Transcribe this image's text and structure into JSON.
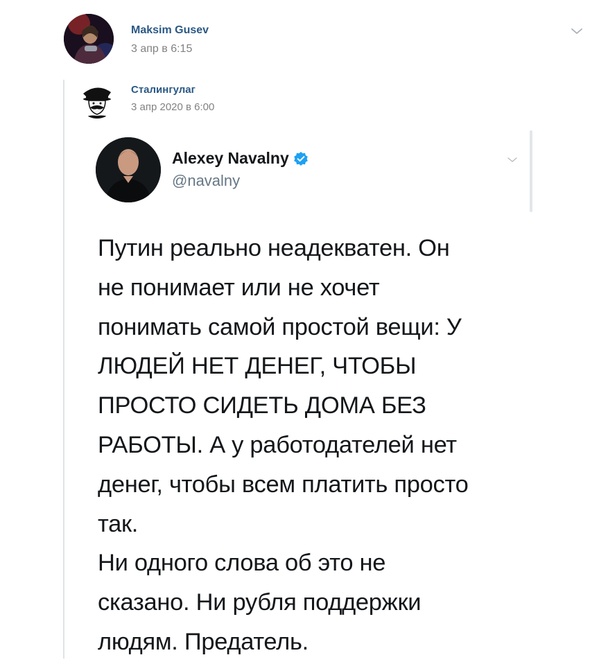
{
  "post": {
    "author": "Maksim Gusev",
    "date": "3 апр в 6:15"
  },
  "repost": {
    "author": "Сталингулаг",
    "date": "3 апр 2020 в 6:00"
  },
  "tweet": {
    "name": "Alexey Navalny",
    "handle": "@navalny",
    "lines": [
      "Путин реально неадекватен. Он",
      "не понимает или не хочет",
      "понимать самой простой вещи: У",
      "ЛЮДЕЙ НЕТ ДЕНЕГ, ЧТОБЫ",
      "ПРОСТО СИДЕТЬ ДОМА БЕЗ",
      "РАБОТЫ. А у работодателей нет",
      "денег, чтобы всем платить просто",
      "так.",
      "Ни одного слова об это не",
      "сказано. Ни рубля поддержки",
      "людям. Предатель."
    ]
  },
  "icons": {
    "menu": "chevron-down-icon",
    "verified": "verified-badge-icon"
  },
  "colors": {
    "link": "#2a5885",
    "muted": "#828282",
    "twitter_blue": "#1da1f2",
    "tweet_text": "#14171a",
    "handle": "#657786"
  }
}
